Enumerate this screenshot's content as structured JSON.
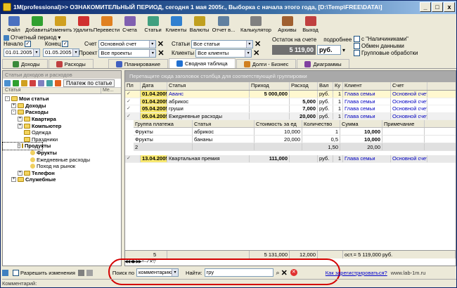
{
  "window": {
    "title": "1M(professional)>> ОЗНАКОМИТЕЛЬНЫЙ ПЕРИОД, сегодня 1 мая 2005г., Выборка с начала этого года, [D:\\Temp\\FREE\\DATA\\]",
    "min": "_",
    "max": "□",
    "close": "x"
  },
  "toolbar": [
    {
      "label": "Файл",
      "icon": "folder-icon",
      "color": "#4a70c0"
    },
    {
      "label": "Добавить",
      "icon": "add-icon",
      "color": "#30a030"
    },
    {
      "label": "Изменить",
      "icon": "edit-icon",
      "color": "#d0a020"
    },
    {
      "label": "Удалить",
      "icon": "delete-icon",
      "color": "#d03030"
    },
    {
      "label": "Перевести",
      "icon": "transfer-icon",
      "color": "#e08020"
    },
    {
      "label": "Счета",
      "icon": "accounts-icon",
      "color": "#8060b0"
    },
    {
      "label": "Статьи",
      "icon": "articles-icon",
      "color": "#40a080"
    },
    {
      "label": "Клиенты",
      "icon": "clients-icon",
      "color": "#3080d0"
    },
    {
      "label": "Валюты",
      "icon": "currency-icon",
      "color": "#c0a020"
    },
    {
      "label": "Отчет в...",
      "icon": "report-icon",
      "color": "#6080a0"
    },
    {
      "label": "Калькулятор",
      "icon": "calculator-icon",
      "color": "#808080"
    },
    {
      "label": "Архивы",
      "icon": "archive-icon",
      "color": "#a06030"
    },
    {
      "label": "Выход",
      "icon": "exit-icon",
      "color": "#c04040"
    }
  ],
  "filters": {
    "period_label": "Отчетный период",
    "start_label": "Начало",
    "start_date": "01.01.2005",
    "end_label": "Конец",
    "end_date": "01.05.2005",
    "account_label": "Счет",
    "account_value": "Основной счет",
    "project_label": "Проект",
    "project_value": "Все проекты",
    "articles_label": "Статьи",
    "articles_value": "Все статьи",
    "clients_label": "Клиенты",
    "clients_value": "Все клиенты",
    "balance_label": "Остаток на счете",
    "balance_value": "5 119,00",
    "currency": "руб.",
    "detail_label": "подробнее",
    "opt_cash": "с \"Наличиниками\"",
    "opt_exchange": "Обмен данными",
    "opt_group": "Групповые обработки"
  },
  "tabs": [
    {
      "label": "Доходы",
      "icon": "income-icon"
    },
    {
      "label": "Расходы",
      "icon": "expense-icon"
    },
    {
      "label": "Планирование",
      "icon": "planning-icon"
    },
    {
      "label": "Сводная таблица",
      "icon": "pivot-icon"
    },
    {
      "label": "Долги - Бизнес",
      "icon": "debts-icon"
    },
    {
      "label": "Диаграммы",
      "icon": "charts-icon"
    }
  ],
  "left": {
    "header": "Статьи доходов и расходов",
    "filter_button": "Платеж по статье",
    "col_article": "Статья",
    "col_me": "Ме...",
    "tree": [
      {
        "label": "Мои статьи",
        "level": 0,
        "bold": true,
        "pm": "-"
      },
      {
        "label": "Доходы",
        "level": 1,
        "bold": true,
        "pm": "+"
      },
      {
        "label": "Расходы",
        "level": 1,
        "bold": true,
        "pm": "-"
      },
      {
        "label": "Квартира",
        "level": 2,
        "bold": true,
        "pm": "+"
      },
      {
        "label": "Компьютер",
        "level": 2,
        "bold": true,
        "pm": "+"
      },
      {
        "label": "Одежда",
        "level": 2,
        "bold": false,
        "pm": ""
      },
      {
        "label": "Праздники",
        "level": 2,
        "bold": false,
        "pm": ""
      },
      {
        "label": "Продукты",
        "level": 2,
        "bold": true,
        "pm": "-"
      },
      {
        "label": "Фрукты",
        "level": 3,
        "bold": true,
        "pm": ""
      },
      {
        "label": "Ежедневные расходы",
        "level": 3,
        "bold": false,
        "pm": ""
      },
      {
        "label": "Поход на рынок",
        "level": 3,
        "bold": false,
        "pm": ""
      },
      {
        "label": "Телефон",
        "level": 2,
        "bold": true,
        "pm": "+"
      },
      {
        "label": "Служебные",
        "level": 1,
        "bold": true,
        "pm": "+"
      }
    ]
  },
  "grid": {
    "group_hint": "Перетащите сюда заголовок столбца для соответствующей группировки",
    "headers": [
      "Пл",
      "Дата",
      "Статья",
      "Приход",
      "Расход",
      "Вал",
      "Ку",
      "Клиент",
      "Счет"
    ],
    "rows": [
      {
        "date": "01.04.2005",
        "article": "Аванс",
        "income": "5 000,000",
        "expense": "",
        "cur": "руб.",
        "rate": "1",
        "client": "Глава семьи",
        "account": "Основной счет",
        "blue": true
      },
      {
        "date": "01.04.2005",
        "article": "абрикос",
        "income": "",
        "expense": "5,000",
        "cur": "руб.",
        "rate": "1",
        "client": "Глава семьи",
        "account": "Основной счет",
        "blue": false
      },
      {
        "date": "05.04.2005",
        "article": "груши",
        "income": "",
        "expense": "7,000",
        "cur": "руб.",
        "rate": "1",
        "client": "Глава семьи",
        "account": "Основной счет",
        "blue": false
      },
      {
        "date": "05.04.2005",
        "article": "Ежедневные расходы",
        "income": "",
        "expense": "20,000",
        "cur": "руб.",
        "rate": "1",
        "client": "Глава семьи",
        "account": "Основной счет",
        "blue": false
      }
    ],
    "sub_headers": [
      "Группа платежа",
      "Статья",
      "Стоимость за ед",
      "Количество",
      "Сумма",
      "Примечание"
    ],
    "sub_rows": [
      [
        "Фрукты",
        "абрикос",
        "10,000",
        "1",
        "10,000",
        ""
      ],
      [
        "Фрукты",
        "бананы",
        "20,000",
        "0,5",
        "10,000",
        ""
      ]
    ],
    "sub_total": [
      "2",
      "",
      "",
      "1,50",
      "20,00",
      ""
    ],
    "last_row": {
      "date": "13.04.2005",
      "article": "Квартальная премия",
      "income": "111,000",
      "expense": "",
      "cur": "руб.",
      "rate": "1",
      "client": "Глава семьи",
      "account": "Основной счет"
    },
    "footer": [
      "5",
      "",
      "5 131,000",
      "12,000",
      "",
      "ост.= 5 119,000 руб."
    ]
  },
  "bottom": {
    "allow_label": "Разрешить изменения",
    "search_by": "Поиск по",
    "search_field": "комментарию",
    "find_label": "Найти:",
    "find_value": "гру",
    "register_link": "Как зарегистрироваться?",
    "site": "www.lab-1m.ru"
  },
  "status": {
    "comment": "Комментарий:"
  }
}
